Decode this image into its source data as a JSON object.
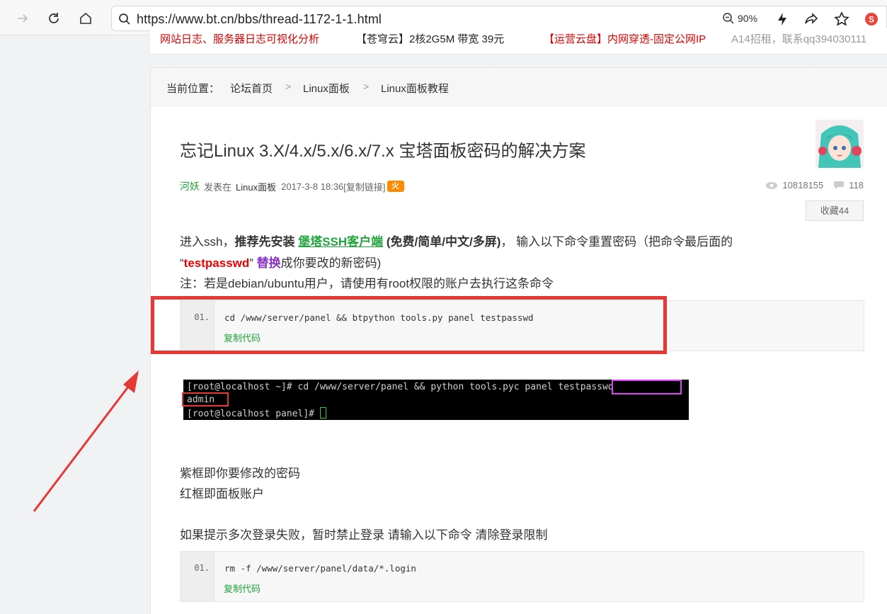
{
  "browser": {
    "url": "https://www.bt.cn/bbs/thread-1172-1-1.html",
    "zoom": "90%"
  },
  "ads": [
    {
      "text": "网站日志、服务器日志可视化分析",
      "color": "#e00000"
    },
    {
      "text": "【苍穹云】2核2G5M 带宽 39元",
      "color": "#222222"
    },
    {
      "text": "【运营云盘】内网穿透-固定公网IP",
      "color": "#e00000"
    },
    {
      "text": "A14招租，联系qq394030111",
      "color": "#999999"
    }
  ],
  "breadcrumb": {
    "label": "当前位置：",
    "items": [
      "论坛首页",
      "Linux面板",
      "Linux面板教程"
    ],
    "separator": ">"
  },
  "post": {
    "title": "忘记Linux 3.X/4.x/5.x/6.x/7.x 宝塔面板密码的解决方案",
    "author": "河妖",
    "posted_in": "发表在",
    "forum": "Linux面板",
    "datetime": "2017-3-8 18:36",
    "copy_link": "[复制链接]",
    "hot_badge": "火",
    "views": "10818155",
    "replies": "118",
    "favorite": "收藏44"
  },
  "body": {
    "p1_a": "进入ssh，",
    "p1_b": "推荐先安装 ",
    "p1_link": "堡塔SSH客户端",
    "p1_c": " (免费/简单/中文/多屏)",
    "p1_d": "， 输入以下命令重置密码（把命令最后面的",
    "p2_a": "“",
    "p2_red": "testpasswd",
    "p2_b": "” ",
    "p2_purple": "替换",
    "p2_c": "成你要改的新密码)",
    "p3": "注：若是debian/ubuntu用户，请使用有root权限的账户去执行这条命令",
    "p4": "紫框即你要修改的密码",
    "p5": "红框即面板账户",
    "p6": "如果提示多次登录失败，暂时禁止登录 请输入以下命令 清除登录限制"
  },
  "code1": {
    "line_no": "01.",
    "code": "cd /www/server/panel && btpython tools.py panel testpasswd",
    "copy": "复制代码"
  },
  "terminal": {
    "line1_prompt": "[root@localhost ~]# cd /www/server/panel && python tools.pyc panel ",
    "line1_pass": "testpasswd",
    "line2": "admin",
    "line3": "[root@localhost panel]# "
  },
  "code2": {
    "line_no": "01.",
    "code": "rm -f /www/server/panel/data/*.login",
    "copy": "复制代码"
  },
  "colors": {
    "accent_green": "#20a53a",
    "highlight_red": "#e53935",
    "highlight_purple": "#e040fb"
  }
}
